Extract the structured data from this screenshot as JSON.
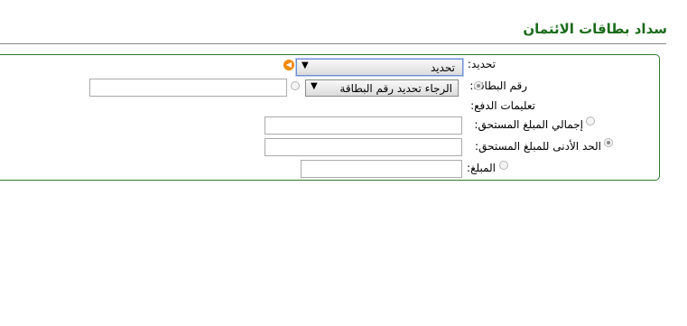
{
  "page": {
    "title": "سداد بطاقات الائتمان"
  },
  "form": {
    "select_label": "تحديد:",
    "select_value": "تحديد",
    "help_icon": "info-arrow-icon",
    "card_number_label": "رقم البطاقة:",
    "card_select_value": "الرجاء تحديد رقم البطاقة",
    "card_manual_value": "",
    "payment_instructions_label": "تعليمات الدفع:",
    "total_due_label": "إجمالي المبلغ المستحق:",
    "total_due_value": "",
    "min_due_label": "الحد الأدنى للمبلغ المستحق:",
    "min_due_value": "",
    "amount_label": "المبلغ:",
    "amount_value": ""
  },
  "colors": {
    "title": "#1a6b1a",
    "panel_border": "#2f7a2f",
    "help_icon": "#f08a00"
  }
}
